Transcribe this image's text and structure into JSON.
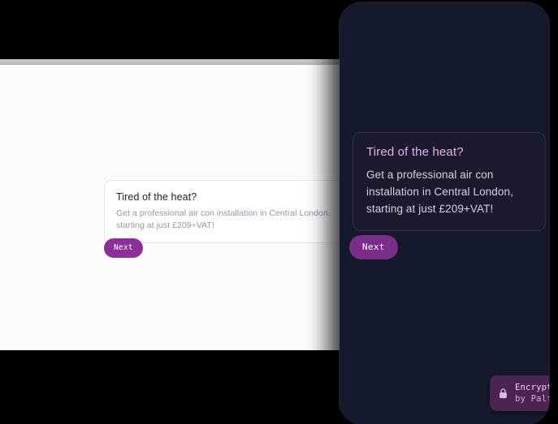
{
  "desktop_preview": {
    "name": "desktop-form-preview",
    "question_card": {
      "title": "Tired of the heat?",
      "description": "Get a professional air con installation in Central London, starting at just £209+VAT!"
    },
    "next_button_label": "Next"
  },
  "mobile_preview": {
    "name": "mobile-form-preview",
    "question_card": {
      "title": "Tired of the heat?",
      "description": "Get a professional air con installation in Central London, starting at just £209+VAT!"
    },
    "next_button_label": "Next",
    "encrypted_badge": {
      "icon": "lock-icon",
      "line1": "Encrypted",
      "line2": "by Palform"
    }
  },
  "colors": {
    "page_background": "#000000",
    "light_panel": "#fbfbfd",
    "light_rim": "#cccccc",
    "light_card": "#ffffff",
    "light_card_border": "#e7e5ea",
    "light_title_text": "#24222b",
    "light_body_text": "#9b92ab",
    "light_button": "#8c2f99",
    "dark_panel": "#141a2b",
    "dark_card_border": "#3a2c48",
    "dark_title_text": "#e3b4ea",
    "dark_body_text": "#d5d3de",
    "dark_button": "#7b2d8a",
    "badge_background": "#4d2351",
    "badge_text": "#e9dcec"
  }
}
